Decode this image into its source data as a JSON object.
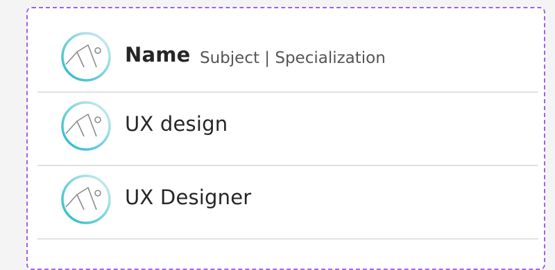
{
  "list": {
    "items": [
      {
        "title": "Name",
        "subtitle": "Subject | Specialization",
        "icon": "image-placeholder-icon"
      },
      {
        "title": "UX design",
        "icon": "image-placeholder-icon"
      },
      {
        "title": "UX Designer",
        "icon": "image-placeholder-icon"
      }
    ]
  },
  "colors": {
    "border_dashed": "#a15ef2",
    "icon_ring_dark": "#22b8c8",
    "icon_ring_light": "#bfe7ee",
    "divider": "#e1e1e1",
    "text": "#262626"
  }
}
